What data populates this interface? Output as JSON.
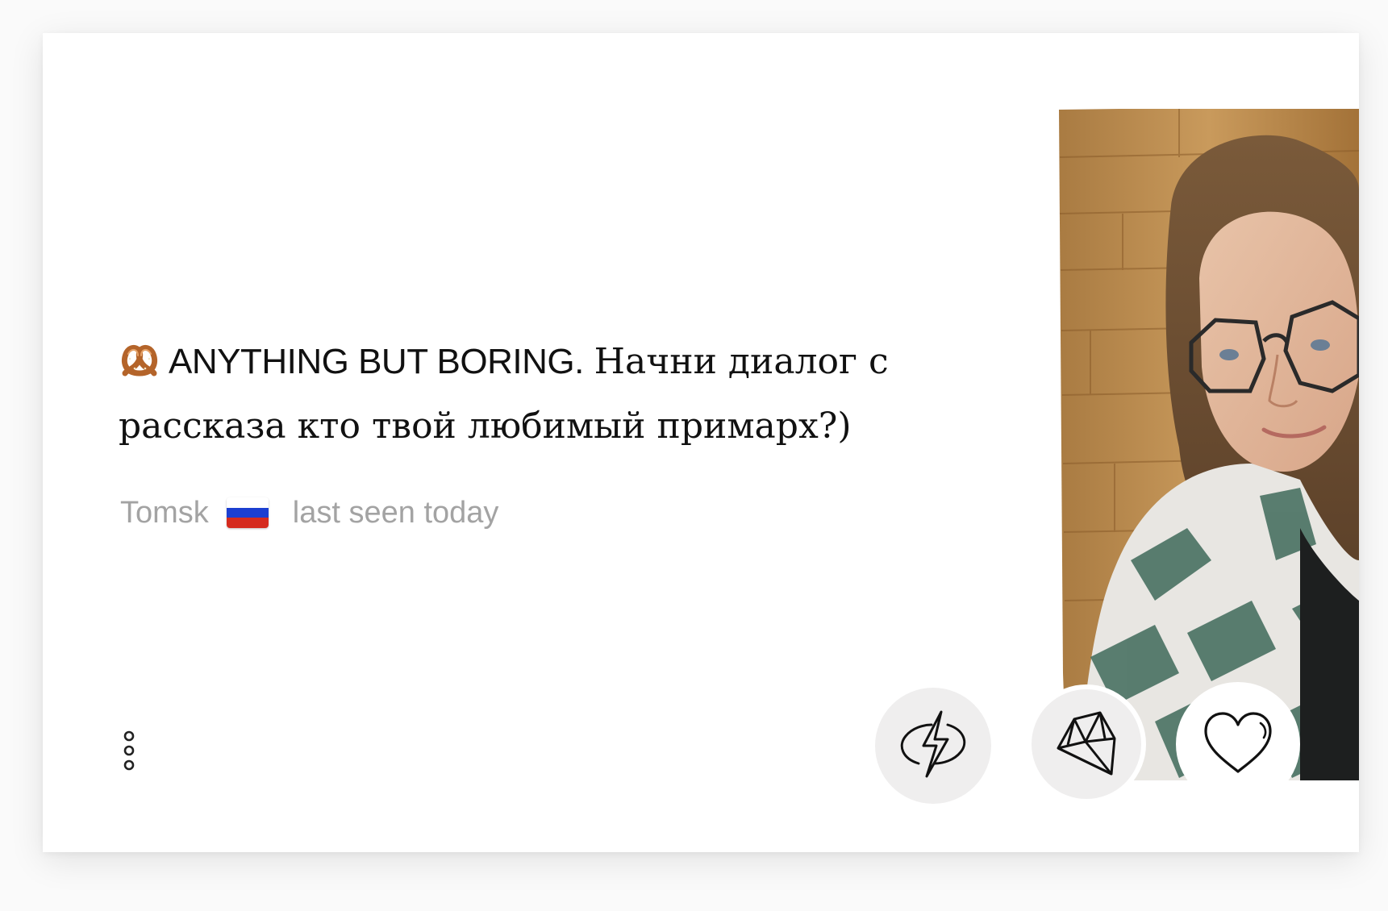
{
  "profile": {
    "headline_emoji": "🥨",
    "headline_title": "ANYTHING BUT BORING.",
    "headline_text": "Начни диалог с рассказа кто твой любимый примарх?)",
    "city": "Tomsk",
    "country_flag": "russia-flag-icon",
    "last_seen": "last seen today",
    "photo": "profile-photo"
  },
  "actions": {
    "more": "more-options-icon",
    "boost": "lightning-icon",
    "gem": "diamond-icon",
    "like": "heart-icon"
  },
  "colors": {
    "text_primary": "#111111",
    "text_muted": "#a3a3a3",
    "button_bg": "#efeeee",
    "flag_white": "#ffffff",
    "flag_blue": "#1c3fd1",
    "flag_red": "#d52b1e"
  }
}
